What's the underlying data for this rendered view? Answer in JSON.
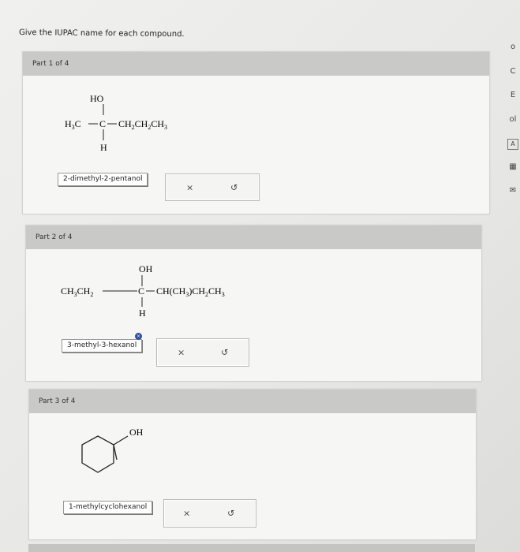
{
  "question": {
    "header": "Give the IUPAC name for each compound."
  },
  "parts": [
    {
      "label": "Part 1 of 4",
      "structure": {
        "top": "HO",
        "left": "H",
        "left_sub": "3",
        "left_c": "C",
        "center": "C",
        "bottom": "H",
        "right": [
          "CH",
          "2",
          "CH",
          "2",
          "CH",
          "3"
        ]
      },
      "answer": "2-dimethyl-2-pentanol",
      "clear_icon": "×",
      "redo_icon": "↺"
    },
    {
      "label": "Part 2 of 4",
      "structure": {
        "top": "OH",
        "left": [
          "CH",
          "3",
          "CH",
          "2"
        ],
        "center": "C",
        "bottom": "H",
        "right": [
          "CH(CH",
          "3",
          ")CH",
          "2",
          "CH",
          "3"
        ]
      },
      "answer": "3-methyl-3-hexanol",
      "error_marker": "×",
      "clear_icon": "×",
      "redo_icon": "↺"
    },
    {
      "label": "Part 3 of 4",
      "structure": {
        "substituent": "OH"
      },
      "answer": "1-methylcyclohexanol",
      "clear_icon": "×",
      "redo_icon": "↺"
    }
  ],
  "sidebar": {
    "icons": [
      "circle-icon",
      "undo-icon",
      "list-icon",
      "chart-icon",
      "text-icon",
      "calculator-icon",
      "mail-icon"
    ],
    "labels": [
      "o",
      "C",
      "E",
      "ol",
      "A",
      "▦",
      "✉"
    ]
  }
}
